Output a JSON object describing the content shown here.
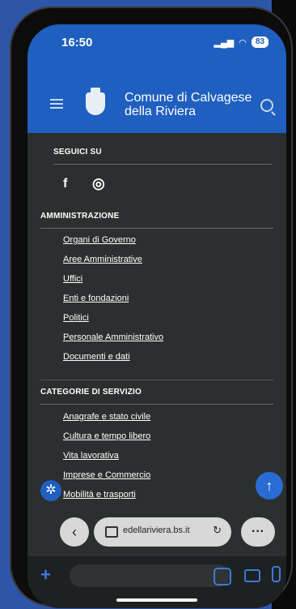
{
  "status": {
    "time": "16:50",
    "battery": "83"
  },
  "header": {
    "title_line1": "Comune di Calvagese",
    "title_line2": "della Riviera"
  },
  "social": {
    "title": "SEGUICI SU",
    "facebook": "f",
    "instagram": "◎"
  },
  "amministrazione": {
    "title": "AMMINISTRAZIONE",
    "links": [
      "Organi di Governo",
      "Aree Amministrative",
      "Uffici",
      "Enti e fondazioni",
      "Politici",
      "Personale Amministrativo",
      "Documenti e dati"
    ]
  },
  "categorie": {
    "title": "CATEGORIE DI SERVIZIO",
    "links": [
      "Anagrafe e stato civile",
      "Cultura e tempo libero",
      "Vita lavorativa",
      "Imprese e Commercio",
      "Mobilità e trasporti"
    ]
  },
  "browser": {
    "url": "edellariviera.bs.it",
    "more": "···",
    "back": "‹",
    "reload": "↻"
  },
  "fab_icon": "↑",
  "a11y_icon": "✲",
  "colors": {
    "brand": "#1f5fbf",
    "bg": "#2c2f30",
    "text": "#ffffff"
  }
}
